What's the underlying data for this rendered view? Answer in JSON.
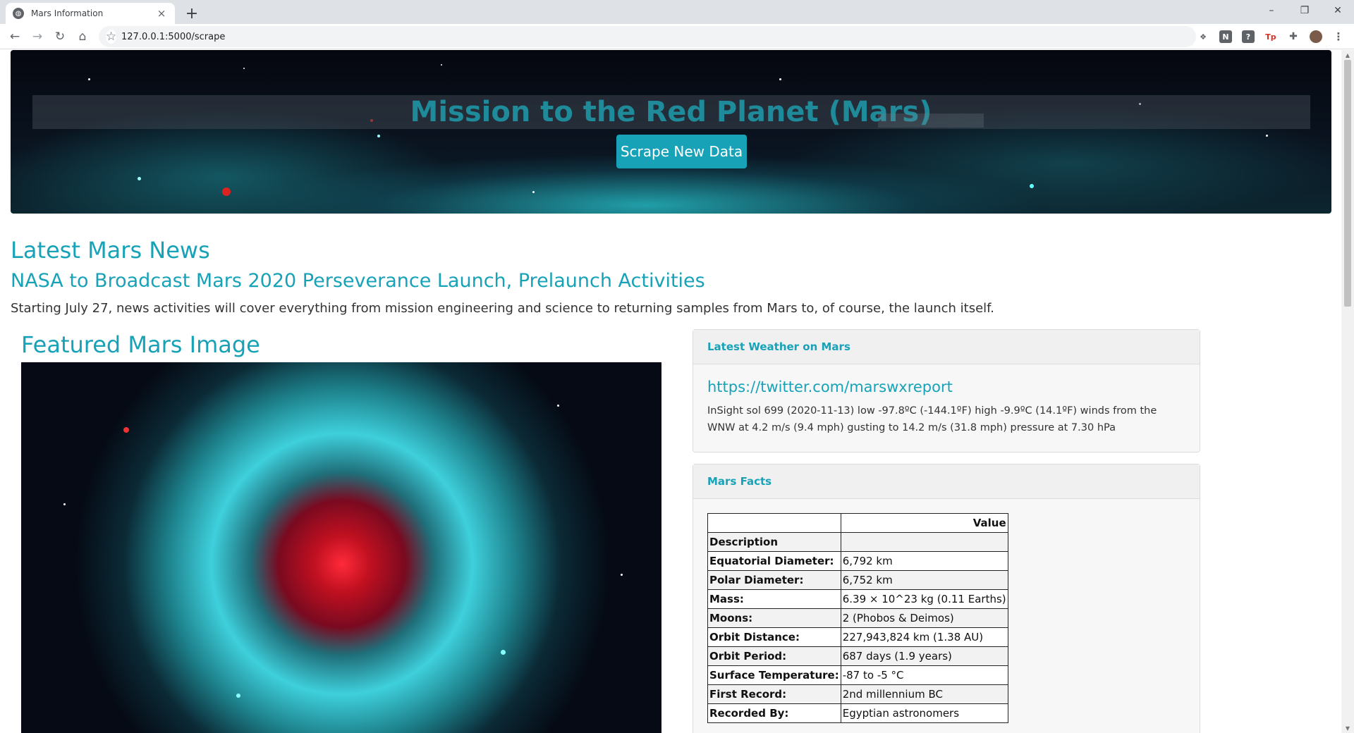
{
  "browser": {
    "tab_title": "Mars Information",
    "tab_close": "×",
    "new_tab": "+",
    "url": "127.0.0.1:5000/scrape",
    "win_min": "–",
    "win_restore": "❐",
    "win_close": "✕"
  },
  "jumbotron": {
    "title": "Mission to the Red Planet (Mars)",
    "button": "Scrape New Data"
  },
  "news": {
    "heading": "Latest Mars News",
    "title": "NASA to Broadcast Mars 2020 Perseverance Launch, Prelaunch Activities",
    "paragraph": "Starting July 27, news activities will cover everything from mission engineering and science to returning samples from Mars to, of course, the launch itself."
  },
  "featured": {
    "heading": "Featured Mars Image"
  },
  "weather": {
    "heading": "Latest Weather on Mars",
    "link": "https://twitter.com/marswxreport",
    "text": "InSight sol 699 (2020-11-13) low -97.8ºC (-144.1ºF) high -9.9ºC (14.1ºF) winds from the WNW at 4.2 m/s (9.4 mph) gusting to 14.2 m/s (31.8 mph) pressure at 7.30 hPa"
  },
  "facts": {
    "heading": "Mars Facts",
    "col_header": "Value",
    "index_name": "Description",
    "rows": [
      {
        "k": "Equatorial Diameter:",
        "v": "6,792 km"
      },
      {
        "k": "Polar Diameter:",
        "v": "6,752 km"
      },
      {
        "k": "Mass:",
        "v": "6.39 × 10^23 kg (0.11 Earths)"
      },
      {
        "k": "Moons:",
        "v": "2 (Phobos & Deimos)"
      },
      {
        "k": "Orbit Distance:",
        "v": "227,943,824 km (1.38 AU)"
      },
      {
        "k": "Orbit Period:",
        "v": "687 days (1.9 years)"
      },
      {
        "k": "Surface Temperature:",
        "v": "-87 to -5 °C"
      },
      {
        "k": "First Record:",
        "v": "2nd millennium BC"
      },
      {
        "k": "Recorded By:",
        "v": "Egyptian astronomers"
      }
    ]
  },
  "colors": {
    "accent": "#17a2b8",
    "title_teal": "#1f8a99"
  }
}
